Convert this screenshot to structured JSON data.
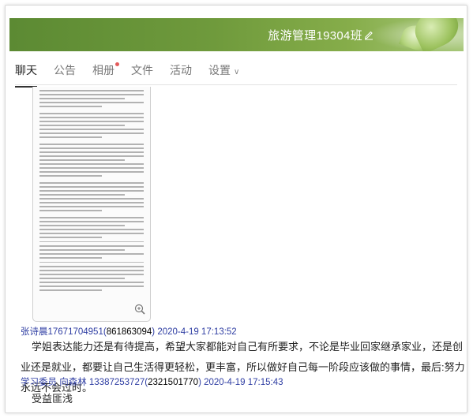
{
  "header": {
    "group_name": "旅游管理19304班",
    "edit_icon": "pencil-icon",
    "accent_color": "#6f9a3c"
  },
  "tabs": [
    {
      "label": "聊天",
      "active": true
    },
    {
      "label": "公告",
      "active": false
    },
    {
      "label": "相册",
      "active": false,
      "badge": true
    },
    {
      "label": "文件",
      "active": false
    },
    {
      "label": "活动",
      "active": false
    },
    {
      "label": "设置",
      "active": false,
      "dropdown": true
    }
  ],
  "messages": [
    {
      "sender": "张诗晨17671704951",
      "qq": "861863094",
      "time": "2020-4-19 17:13:52",
      "text": "学姐表达能力还是有待提高，希望大家都能对自己有所要求，不论是毕业回家继承家业，还是创业还是就业，都要让自己生活得更轻松，更丰富，所以做好自己每一阶段应该做的事情，最后:努力永远不会过时。"
    },
    {
      "sender": "学习委员 向森林 13387253727",
      "qq": "2321501770",
      "time": "2020-4-19 17:15:43",
      "text": "受益匪浅"
    }
  ]
}
